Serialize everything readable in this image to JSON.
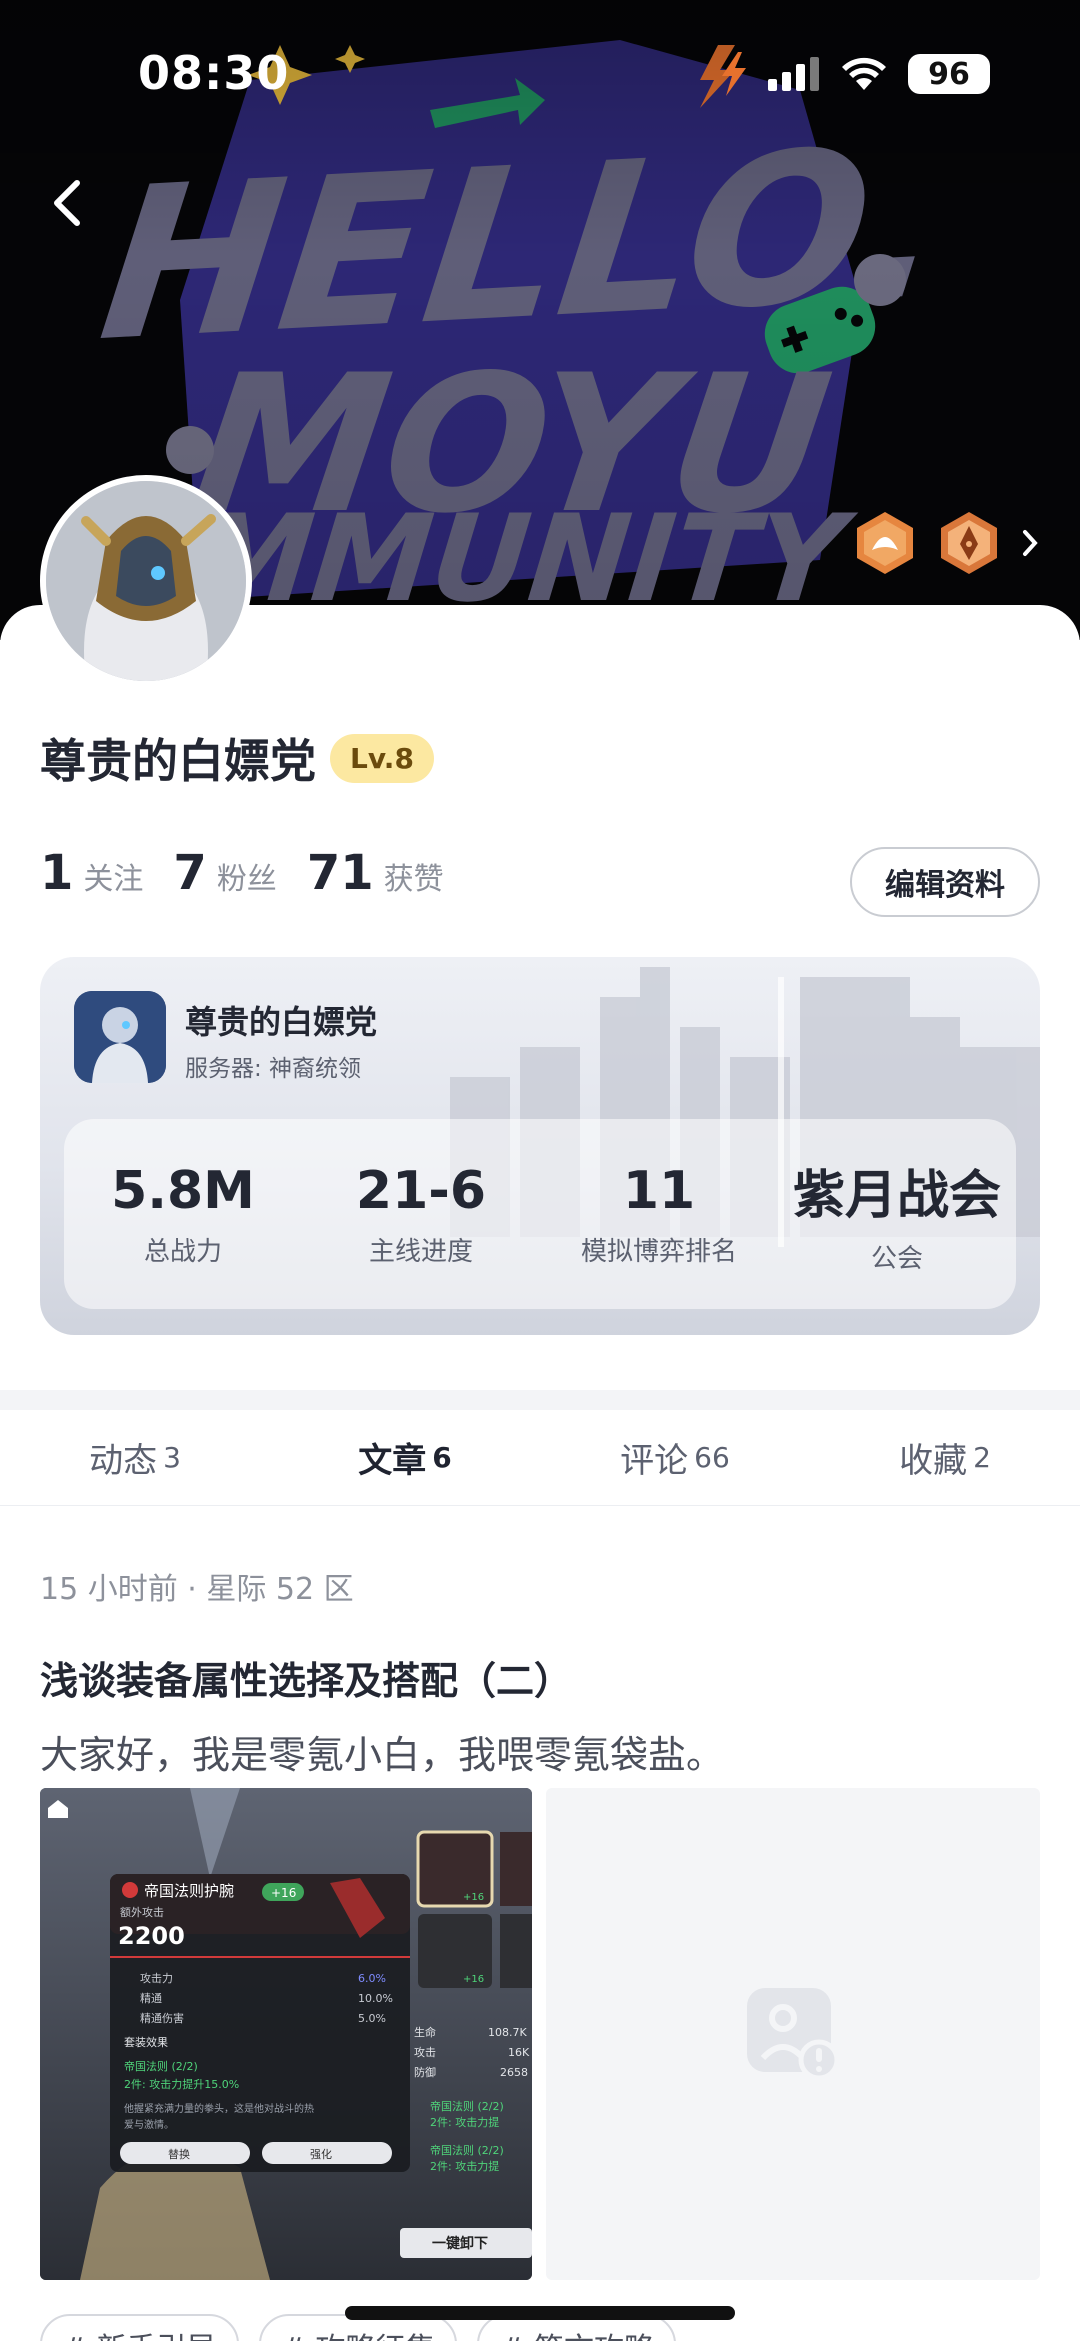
{
  "status_bar": {
    "time": "08:30",
    "battery": "96",
    "icons": [
      "charging-bolt-icon",
      "signal-icon",
      "wifi-icon",
      "battery-icon"
    ]
  },
  "banner": {
    "art_text": [
      "HELLO.",
      "MOYU",
      "COMMUNITY"
    ],
    "colors": {
      "bg": "#050507",
      "letters": "#55546c",
      "blob": "#2d2775"
    }
  },
  "profile": {
    "name": "尊贵的白嫖党",
    "level": "Lv.8",
    "stats": [
      {
        "num": "1",
        "label": "关注"
      },
      {
        "num": "7",
        "label": "粉丝"
      },
      {
        "num": "71",
        "label": "获赞"
      }
    ],
    "edit_label": "编辑资料"
  },
  "game_card": {
    "name": "尊贵的白嫖党",
    "server": "服务器: 神裔统领",
    "stats": [
      {
        "value": "5.8M",
        "label": "总战力"
      },
      {
        "value": "21-6",
        "label": "主线进度"
      },
      {
        "value": "11",
        "label": "模拟博弈排名"
      },
      {
        "value": "紫月战会",
        "label": "公会"
      }
    ]
  },
  "tabs": [
    {
      "label": "动态",
      "count": "3",
      "active": false
    },
    {
      "label": "文章",
      "count": "6",
      "active": true
    },
    {
      "label": "评论",
      "count": "66",
      "active": false
    },
    {
      "label": "收藏",
      "count": "2",
      "active": false
    }
  ],
  "post": {
    "meta": "15 小时前 · 星际 52 区",
    "title": "浅谈装备属性选择及搭配（二）",
    "excerpt": "大家好，我是零氪小白，我喂零氪袋盐。",
    "image1": {
      "item_name": "帝国法则护腕",
      "item_plus": "+16",
      "sub": "额外攻击",
      "value": "2200",
      "lines": [
        {
          "k": "攻击力",
          "v": "6.0%"
        },
        {
          "k": "精通",
          "v": "10.0%"
        },
        {
          "k": "精通伤害",
          "v": "5.0%"
        }
      ],
      "set_title": "套装效果",
      "set_name": "帝国法则 (2/2)",
      "set_bonus": "2件: 攻击力提升15.0%",
      "desc1": "他握紧充满力量的拳头，这是他对战斗的热",
      "desc2": "爱与激情。",
      "btn_replace": "替换",
      "btn_strengthen": "强化",
      "side_stats": [
        {
          "k": "生命",
          "v": "108.7K"
        },
        {
          "k": "攻击",
          "v": "16K"
        },
        {
          "k": "防御",
          "v": "2658"
        }
      ],
      "side_set1": "帝国法则 (2/2)",
      "side_set1b": "2件: 攻击力提",
      "side_set2": "帝国法则 (2/2)",
      "side_set2b": "2件: 攻击力提",
      "unequip": "一键卸下",
      "slot_plus1": "+16",
      "slot_plus2": "+16"
    },
    "tags": [
      "# 新手引导",
      "# 攻略征集",
      "# 符文攻略"
    ]
  }
}
